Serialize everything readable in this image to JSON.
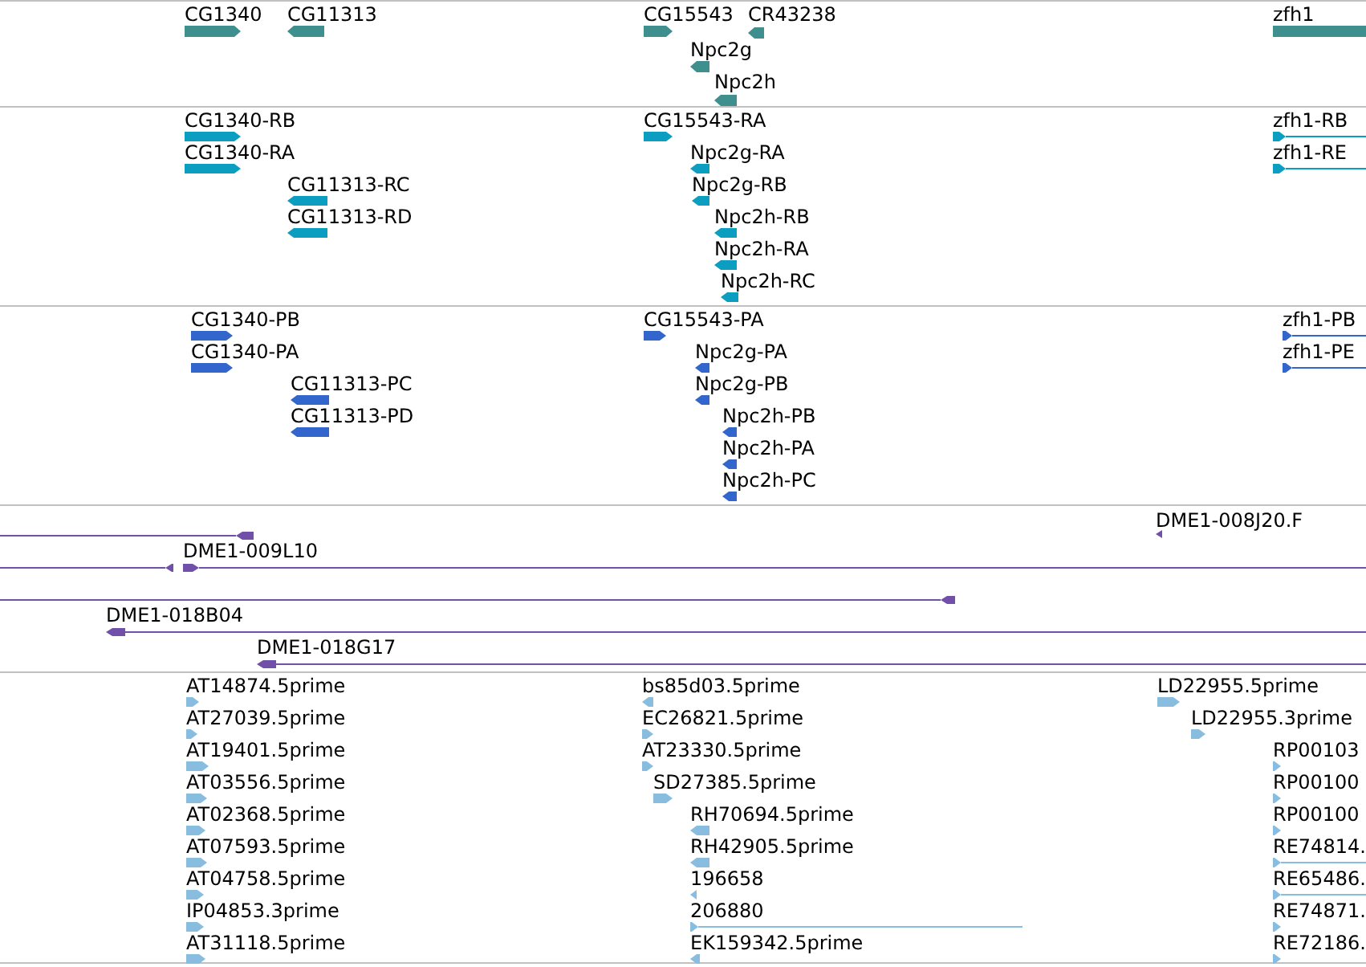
{
  "tracks": [
    {
      "color": "#3f8f8f",
      "features": [
        {
          "label": "CG1340",
          "kind": "forward"
        },
        {
          "label": "CG11313",
          "kind": "reverse"
        },
        {
          "label": "CG15543",
          "kind": "forward"
        },
        {
          "label": "CR43238",
          "kind": "reverse"
        },
        {
          "label": "Npc2g",
          "kind": "reverse"
        },
        {
          "label": "Npc2h",
          "kind": "reverse"
        },
        {
          "label": "zfh1",
          "kind": "forward"
        }
      ]
    },
    {
      "color": "#0c9ec0",
      "features": [
        {
          "label": "CG1340-RB",
          "kind": "forward"
        },
        {
          "label": "CG1340-RA",
          "kind": "forward"
        },
        {
          "label": "CG11313-RC",
          "kind": "reverse"
        },
        {
          "label": "CG11313-RD",
          "kind": "reverse"
        },
        {
          "label": "CG15543-RA",
          "kind": "forward"
        },
        {
          "label": "Npc2g-RA",
          "kind": "reverse"
        },
        {
          "label": "Npc2g-RB",
          "kind": "reverse"
        },
        {
          "label": "Npc2h-RB",
          "kind": "reverse"
        },
        {
          "label": "Npc2h-RA",
          "kind": "reverse"
        },
        {
          "label": "Npc2h-RC",
          "kind": "reverse"
        },
        {
          "label": "zfh1-RB",
          "kind": "forward"
        },
        {
          "label": "zfh1-RE",
          "kind": "forward"
        }
      ]
    },
    {
      "color": "#3366cc",
      "features": [
        {
          "label": "CG1340-PB",
          "kind": "forward"
        },
        {
          "label": "CG1340-PA",
          "kind": "forward"
        },
        {
          "label": "CG11313-PC",
          "kind": "reverse"
        },
        {
          "label": "CG11313-PD",
          "kind": "reverse"
        },
        {
          "label": "CG15543-PA",
          "kind": "forward"
        },
        {
          "label": "Npc2g-PA",
          "kind": "reverse"
        },
        {
          "label": "Npc2g-PB",
          "kind": "reverse"
        },
        {
          "label": "Npc2h-PB",
          "kind": "reverse"
        },
        {
          "label": "Npc2h-PA",
          "kind": "reverse"
        },
        {
          "label": "Npc2h-PC",
          "kind": "reverse"
        },
        {
          "label": "zfh1-PB",
          "kind": "forward"
        },
        {
          "label": "zfh1-PE",
          "kind": "forward"
        }
      ]
    },
    {
      "color": "#7050a8",
      "features": [
        {
          "kind": "reverse"
        },
        {
          "label": "DME1-008J20.F",
          "kind": "reverse"
        },
        {
          "label": "DME1-009L10",
          "kind": "forward"
        },
        {
          "kind": "reverse"
        },
        {
          "kind": "reverse"
        },
        {
          "label": "DME1-018B04",
          "kind": "reverse"
        },
        {
          "label": "DME1-018G17",
          "kind": "reverse"
        }
      ]
    },
    {
      "color": "#88bde0",
      "features": [
        {
          "label": "AT14874.5prime",
          "kind": "forward"
        },
        {
          "label": "AT27039.5prime",
          "kind": "forward"
        },
        {
          "label": "AT19401.5prime",
          "kind": "forward"
        },
        {
          "label": "AT03556.5prime",
          "kind": "forward"
        },
        {
          "label": "AT02368.5prime",
          "kind": "forward"
        },
        {
          "label": "AT07593.5prime",
          "kind": "forward"
        },
        {
          "label": "AT04758.5prime",
          "kind": "forward"
        },
        {
          "label": "IP04853.3prime",
          "kind": "forward"
        },
        {
          "label": "AT31118.5prime",
          "kind": "forward"
        },
        {
          "label": "bs85d03.5prime",
          "kind": "reverse"
        },
        {
          "label": "EC26821.5prime",
          "kind": "forward"
        },
        {
          "label": "AT23330.5prime",
          "kind": "forward"
        },
        {
          "label": "SD27385.5prime",
          "kind": "forward"
        },
        {
          "label": "RH70694.5prime",
          "kind": "reverse"
        },
        {
          "label": "RH42905.5prime",
          "kind": "reverse"
        },
        {
          "label": "196658",
          "kind": "reverse"
        },
        {
          "label": "206880",
          "kind": "forward"
        },
        {
          "label": "EK159342.5prime",
          "kind": "reverse"
        },
        {
          "label": "LD22955.5prime",
          "kind": "forward"
        },
        {
          "label": "LD22955.3prime",
          "kind": "forward"
        },
        {
          "label": "RP00103",
          "kind": "forward"
        },
        {
          "label": "RP00100",
          "kind": "forward"
        },
        {
          "label": "RP00100",
          "kind": "forward"
        },
        {
          "label": "RE74814.",
          "kind": "forward"
        },
        {
          "label": "RE65486.",
          "kind": "forward"
        },
        {
          "label": "RE74871.",
          "kind": "forward"
        },
        {
          "label": "RE72186.",
          "kind": "forward"
        }
      ]
    }
  ]
}
